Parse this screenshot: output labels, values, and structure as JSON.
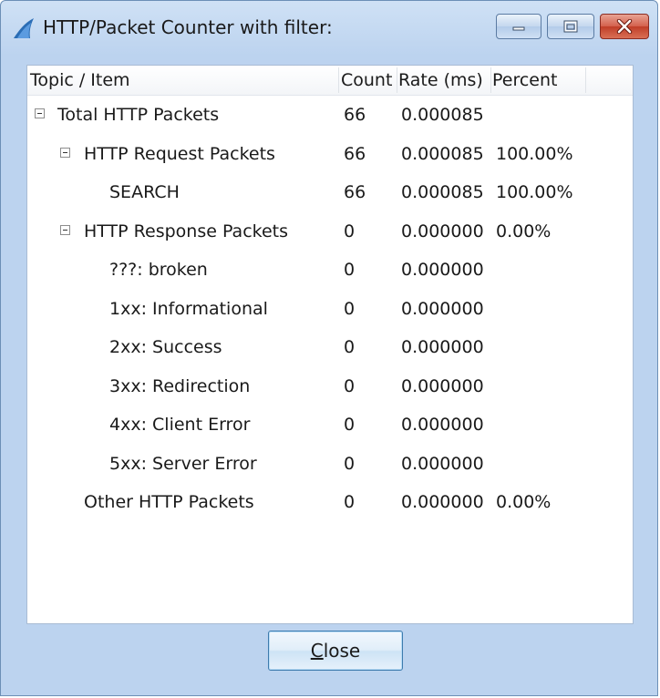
{
  "window": {
    "title": "HTTP/Packet Counter with filter:"
  },
  "columns": {
    "topic": "Topic / Item",
    "count": "Count",
    "rate": "Rate (ms)",
    "percent": "Percent"
  },
  "rows": [
    {
      "label": "Total HTTP Packets",
      "count": "66",
      "rate": "0.000085",
      "percent": "",
      "level": 0,
      "expanded": true
    },
    {
      "label": "HTTP Request Packets",
      "count": "66",
      "rate": "0.000085",
      "percent": "100.00%",
      "level": 1,
      "expanded": true
    },
    {
      "label": "SEARCH",
      "count": "66",
      "rate": "0.000085",
      "percent": "100.00%",
      "level": 2
    },
    {
      "label": "HTTP Response Packets",
      "count": "0",
      "rate": "0.000000",
      "percent": "0.00%",
      "level": 1,
      "expanded": true
    },
    {
      "label": "???: broken",
      "count": "0",
      "rate": "0.000000",
      "percent": "",
      "level": 2
    },
    {
      "label": "1xx: Informational",
      "count": "0",
      "rate": "0.000000",
      "percent": "",
      "level": 2
    },
    {
      "label": "2xx: Success",
      "count": "0",
      "rate": "0.000000",
      "percent": "",
      "level": 2
    },
    {
      "label": "3xx: Redirection",
      "count": "0",
      "rate": "0.000000",
      "percent": "",
      "level": 2
    },
    {
      "label": "4xx: Client Error",
      "count": "0",
      "rate": "0.000000",
      "percent": "",
      "level": 2
    },
    {
      "label": "5xx: Server Error",
      "count": "0",
      "rate": "0.000000",
      "percent": "",
      "level": 2
    },
    {
      "label": "Other HTTP Packets",
      "count": "0",
      "rate": "0.000000",
      "percent": "0.00%",
      "level": 1
    }
  ],
  "buttons": {
    "close": "Close"
  },
  "icons": {
    "app": "wireshark-fin-icon",
    "minimize": "minimize-icon",
    "maximize": "maximize-icon",
    "close": "close-icon",
    "expand": "collapse-toggle-icon"
  },
  "colors": {
    "frame": "#bcd3ef",
    "close_button_red": "#c03e28",
    "app_icon_blue": "#2a6db5"
  }
}
